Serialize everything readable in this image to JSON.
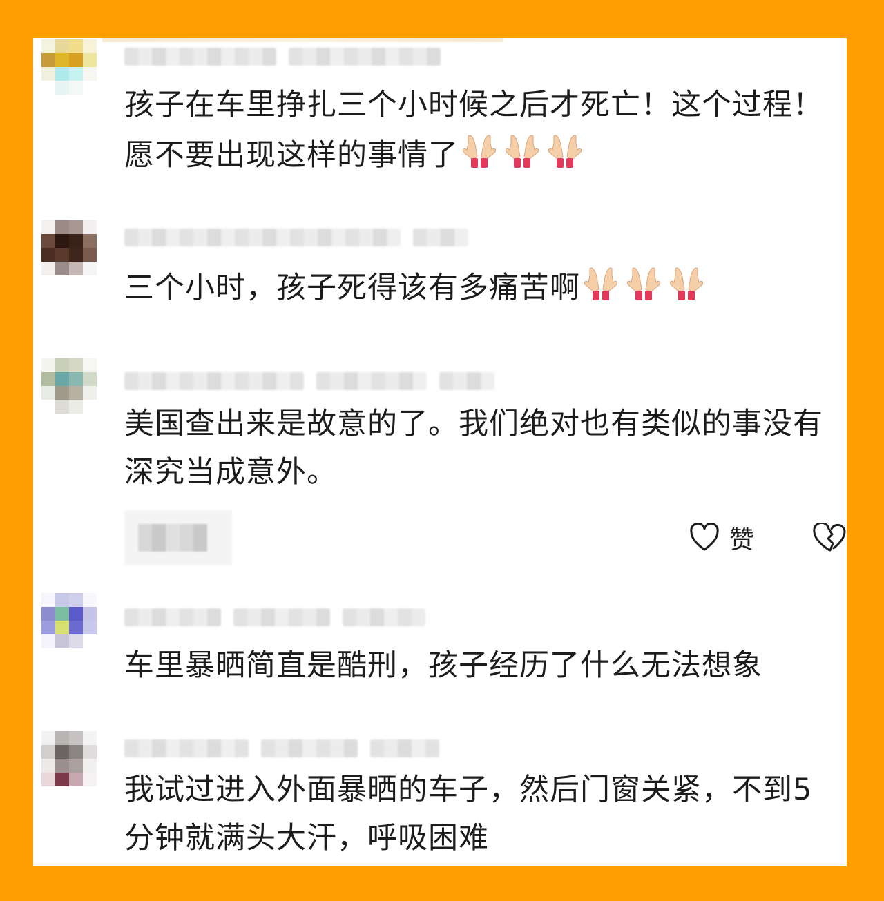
{
  "comments": [
    {
      "text": "孩子在车里挣扎三个小时候之后才死亡！这个过程！愿不要出现这样的事情了",
      "emoji": "🙏🙏🙏"
    },
    {
      "text": "三个小时，孩子死得该有多痛苦啊",
      "emoji": "🙏🙏🙏"
    },
    {
      "text": "美国查出来是故意的了。我们绝对也有类似的事没有深究当成意外。",
      "emoji": ""
    },
    {
      "text": "车里暴晒简直是酷刑，孩子经历了什么无法想象",
      "emoji": ""
    },
    {
      "text": "我试过进入外面暴晒的车子，然后门窗关紧，不到5分钟就满头大汗，呼吸困难",
      "emoji": ""
    }
  ],
  "actions": {
    "like_label": "赞",
    "like_icon": "heart-outline-icon",
    "dislike_icon": "broken-heart-icon"
  },
  "colors": {
    "frame": "#ff9c00",
    "panel": "#ffffff",
    "text": "#1c1c1c"
  }
}
